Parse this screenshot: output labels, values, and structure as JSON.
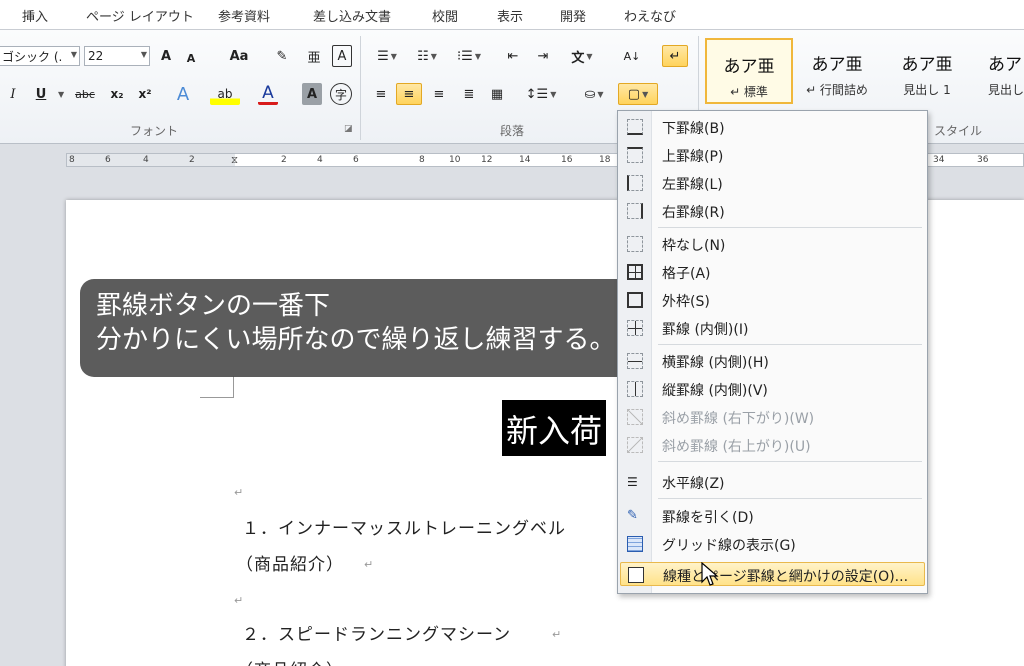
{
  "ribbon_tabs": [
    "挿入",
    "ページ レイアウト",
    "参考資料",
    "差し込み文書",
    "校閲",
    "表示",
    "開発",
    "わえなび"
  ],
  "font": {
    "name": "ゴシック (.",
    "size": "22",
    "group_label": "フォント",
    "grow": "A",
    "shrink": "A",
    "case": "Aa",
    "italic": "I",
    "underline": "U",
    "strike": "abc",
    "subscript": "x₂",
    "superscript": "x²",
    "color_a": "A",
    "shade_a": "A",
    "enclose": "字"
  },
  "paragraph": {
    "group_label": "段落"
  },
  "styles": {
    "group_label": "スタイル",
    "items": [
      {
        "sample": "あア亜",
        "name": "↵ 標準"
      },
      {
        "sample": "あア亜",
        "name": "↵ 行間詰め"
      },
      {
        "sample": "あア亜",
        "name": "見出し 1"
      },
      {
        "sample": "あア",
        "name": "見出し"
      }
    ]
  },
  "ruler": {
    "ticks": [
      "8",
      "6",
      "4",
      "2",
      "2",
      "4",
      "6",
      "8",
      "10",
      "12",
      "14",
      "16",
      "18",
      "34",
      "36"
    ]
  },
  "caption": {
    "line1": "罫線ボタンの一番下",
    "line2": "分かりにくい場所なので繰り返し練習する。"
  },
  "document": {
    "title_fragment": "新入荷",
    "item1": "１．インナーマッスルトレーニングベル",
    "item1_note": "（商品紹介）",
    "item2": "２．スピードランニングマシーン",
    "item2_note": "（商品紹介）",
    "return_mark": "↵",
    "pilcrow_mark": "↵"
  },
  "border_menu": {
    "items": [
      {
        "label": "下罫線(B)",
        "enabled": true
      },
      {
        "label": "上罫線(P)",
        "enabled": true
      },
      {
        "label": "左罫線(L)",
        "enabled": true
      },
      {
        "label": "右罫線(R)",
        "enabled": true
      },
      {
        "label": "枠なし(N)",
        "enabled": true
      },
      {
        "label": "格子(A)",
        "enabled": true
      },
      {
        "label": "外枠(S)",
        "enabled": true
      },
      {
        "label": "罫線 (内側)(I)",
        "enabled": true
      },
      {
        "label": "横罫線 (内側)(H)",
        "enabled": true
      },
      {
        "label": "縦罫線 (内側)(V)",
        "enabled": true
      },
      {
        "label": "斜め罫線 (右下がり)(W)",
        "enabled": false
      },
      {
        "label": "斜め罫線 (右上がり)(U)",
        "enabled": false
      },
      {
        "label": "水平線(Z)",
        "enabled": true
      },
      {
        "label": "罫線を引く(D)",
        "enabled": true
      },
      {
        "label": "グリッド線の表示(G)",
        "enabled": true
      },
      {
        "label": "線種とページ罫線と網かけの設定(O)...",
        "enabled": true,
        "highlighted": true
      }
    ]
  },
  "colors": {
    "accent_highlight": "#ffd35c",
    "caption_bg": "#464646",
    "menu_hover": "#ffe289"
  }
}
